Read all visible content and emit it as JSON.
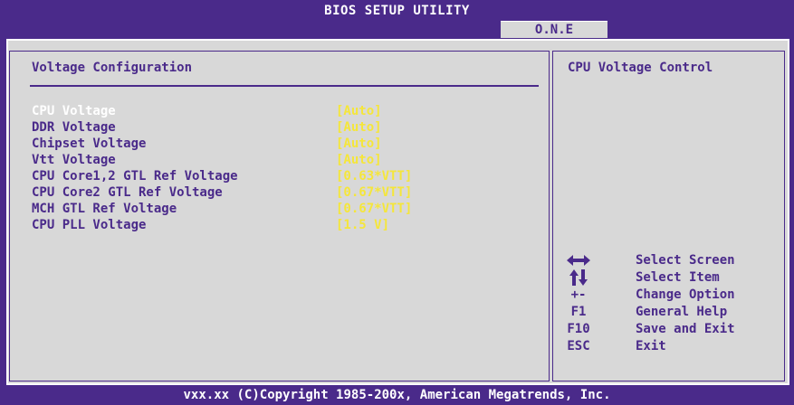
{
  "header": {
    "title": "BIOS SETUP UTILITY",
    "tab": "O.N.E"
  },
  "section": {
    "title": "Voltage Configuration"
  },
  "settings": [
    {
      "label": "CPU Voltage",
      "value": "[Auto]",
      "selected": true
    },
    {
      "label": "DDR Voltage",
      "value": "[Auto]"
    },
    {
      "label": "Chipset Voltage",
      "value": "[Auto]"
    },
    {
      "label": "Vtt Voltage",
      "value": "[Auto]"
    },
    {
      "label": "CPU Core1,2 GTL Ref Voltage",
      "value": "[0.63*VTT]"
    },
    {
      "label": "CPU Core2 GTL Ref Voltage",
      "value": "[0.67*VTT]"
    },
    {
      "label": "MCH GTL Ref Voltage",
      "value": "[0.67*VTT]"
    },
    {
      "label": "CPU PLL Voltage",
      "value": "[1.5 V]"
    }
  ],
  "help": {
    "title": "CPU Voltage Control"
  },
  "legend": [
    {
      "key": "",
      "icon": "left-right-arrows-icon",
      "label": "Select Screen"
    },
    {
      "key": "",
      "icon": "up-down-arrows-icon",
      "label": "Select Item"
    },
    {
      "key": "+-",
      "label": "Change Option"
    },
    {
      "key": "F1",
      "label": "General Help"
    },
    {
      "key": "F10",
      "label": "Save and Exit"
    },
    {
      "key": "ESC",
      "label": "Exit"
    }
  ],
  "footer": {
    "copyright": "vxx.xx (C)Copyright 1985-200x, American Megatrends, Inc."
  },
  "colors": {
    "background": "#4a2a8a",
    "panel": "#d8d8d8",
    "value": "#f5e63a",
    "selected": "#ffffff"
  }
}
